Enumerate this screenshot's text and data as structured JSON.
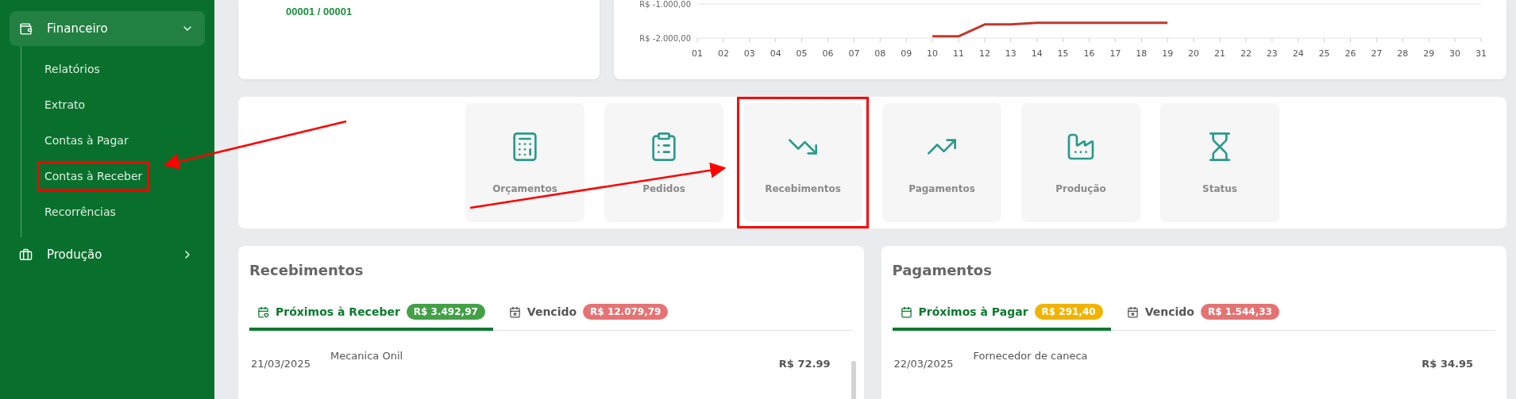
{
  "sidebar": {
    "groups": [
      {
        "label": "Financeiro",
        "expanded": true,
        "children": [
          {
            "label": "Relatórios",
            "annotated": false
          },
          {
            "label": "Extrato",
            "annotated": false
          },
          {
            "label": "Contas à Pagar",
            "annotated": false
          },
          {
            "label": "Contas à Receber",
            "annotated": true
          },
          {
            "label": "Recorrências",
            "annotated": false
          }
        ]
      },
      {
        "label": "Produção",
        "expanded": false
      }
    ]
  },
  "summary_card": {
    "counter": "00001 / 00001"
  },
  "chart": {
    "chart_data": {
      "type": "line",
      "categories": [
        "01",
        "02",
        "03",
        "04",
        "05",
        "06",
        "07",
        "08",
        "09",
        "10",
        "11",
        "12",
        "13",
        "14",
        "15",
        "16",
        "17",
        "18",
        "19",
        "20",
        "21",
        "22",
        "23",
        "24",
        "25",
        "26",
        "27",
        "28",
        "29",
        "30",
        "31"
      ],
      "ylim": [
        -2000,
        -1000
      ],
      "yticks": [
        {
          "value": -1000,
          "label": "R$ -1.000,00"
        },
        {
          "value": -2000,
          "label": "R$ -2.000,00"
        }
      ],
      "series": [
        {
          "color": "#c0392b",
          "values": [
            null,
            null,
            null,
            null,
            null,
            null,
            null,
            null,
            null,
            -1950,
            -1950,
            -1600,
            -1600,
            -1550,
            -1550,
            -1550,
            -1550,
            -1550,
            -1550,
            null,
            null,
            null,
            null,
            null,
            null,
            null,
            null,
            null,
            null,
            null,
            null
          ]
        }
      ]
    }
  },
  "shortcuts": [
    {
      "label": "Orçamentos",
      "annotated": false
    },
    {
      "label": "Pedidos",
      "annotated": false
    },
    {
      "label": "Recebimentos",
      "annotated": true
    },
    {
      "label": "Pagamentos",
      "annotated": false
    },
    {
      "label": "Produção",
      "annotated": false
    },
    {
      "label": "Status",
      "annotated": false
    }
  ],
  "panels": [
    {
      "title": "Recebimentos",
      "tabs": [
        {
          "label": "Próximos à Receber",
          "badge": "R$ 3.492,97",
          "color": "#43a047",
          "selected": true
        },
        {
          "label": "Vencido",
          "badge": "R$ 12.079,79",
          "color": "#e57373",
          "selected": false
        }
      ],
      "rows": [
        {
          "date": "21/03/2025",
          "name": "Mecanica Onil",
          "amount": "R$ 72.99"
        }
      ]
    },
    {
      "title": "Pagamentos",
      "tabs": [
        {
          "label": "Próximos à Pagar",
          "badge": "R$ 291,40",
          "color": "#f0b400",
          "selected": true
        },
        {
          "label": "Vencido",
          "badge": "R$ 1.544,33",
          "color": "#e57373",
          "selected": false
        }
      ],
      "rows": [
        {
          "date": "22/03/2025",
          "name": "Fornecedor de caneca",
          "amount": "R$ 34.95"
        }
      ]
    }
  ]
}
